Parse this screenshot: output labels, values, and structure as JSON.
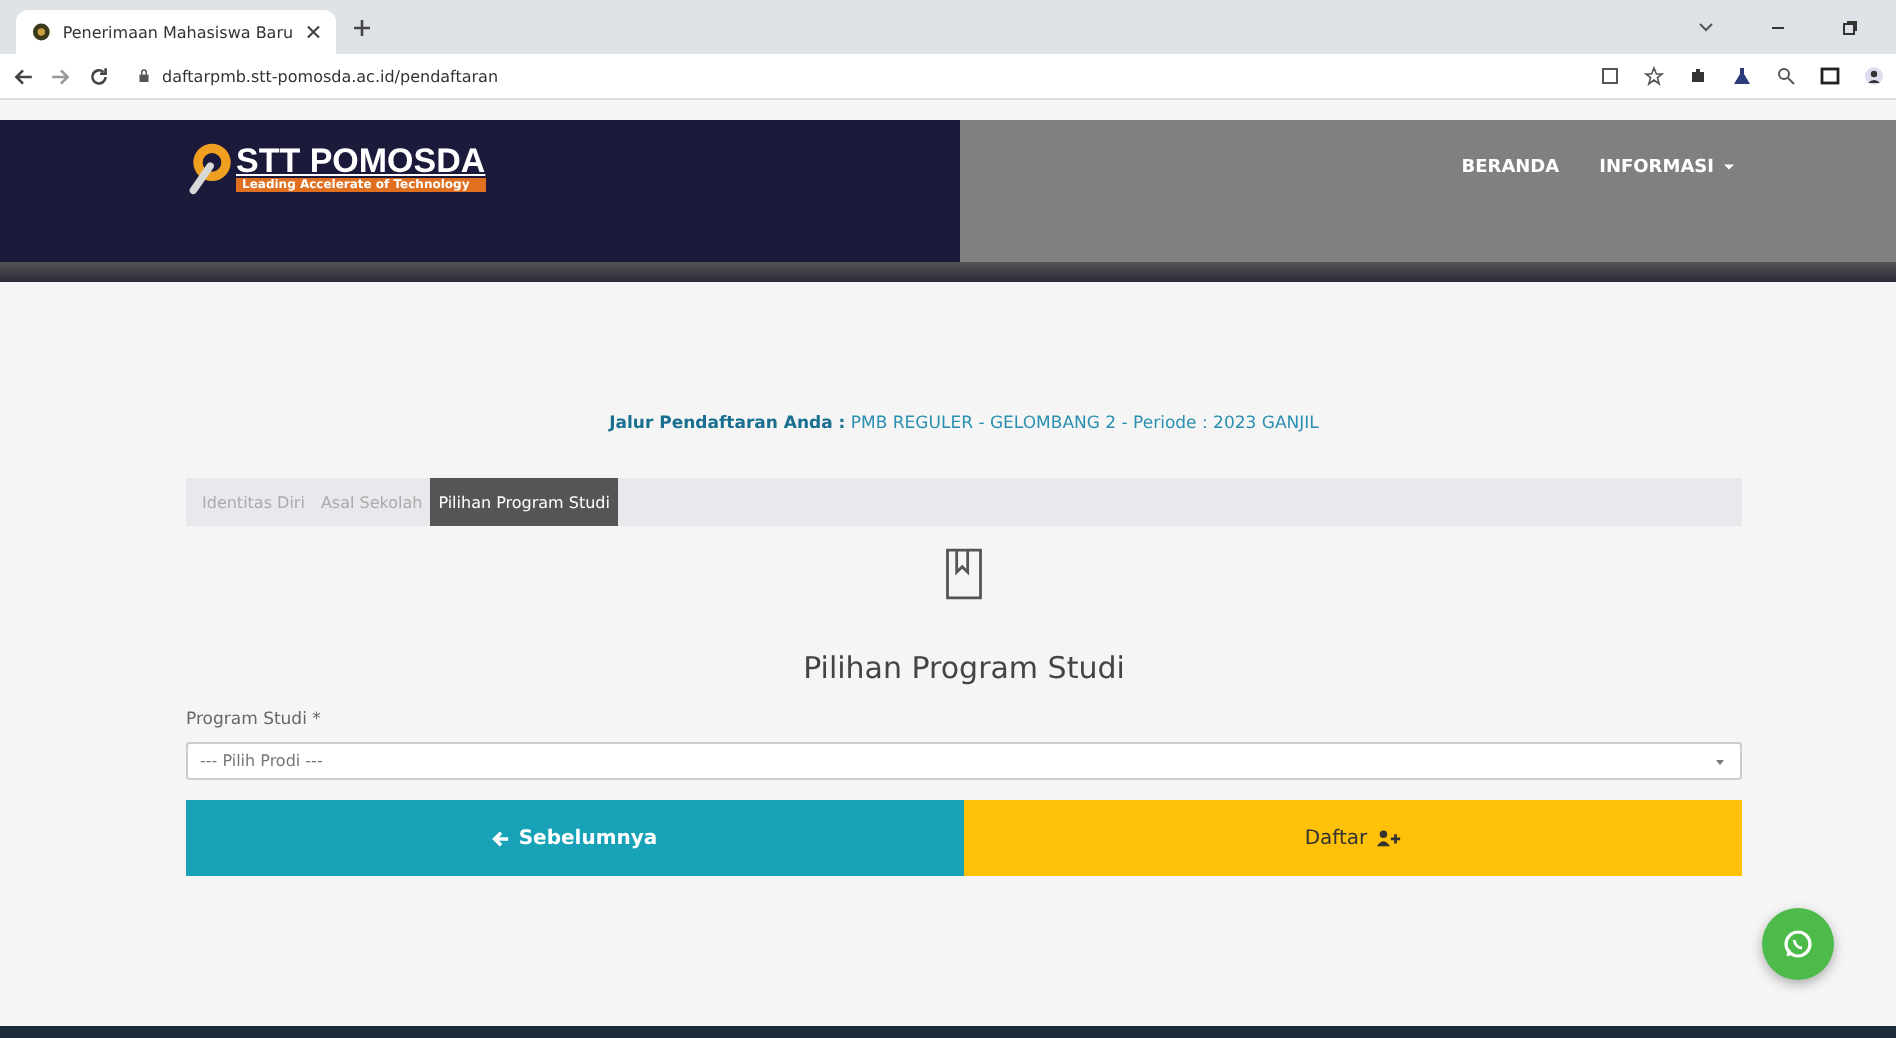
{
  "browser": {
    "tab_title": "Penerimaan Mahasiswa Baru",
    "url": "daftarpmb.stt-pomosda.ac.id/pendaftaran"
  },
  "header": {
    "logo_name": "STT POMOSDA",
    "logo_tagline": "Leading Accelerate of Technology",
    "nav": [
      {
        "label": "BERANDA",
        "dropdown": false
      },
      {
        "label": "INFORMASI",
        "dropdown": true
      }
    ]
  },
  "route": "**Jalur Pendaftaran Anda :** PMB REGULER - GELOMBANG 2 - Periode : 2023 GANJIL",
  "steps": [
    {
      "label": "Identitas Diri",
      "selected": false
    },
    {
      "label": "Asal Sekolah",
      "selected": false
    },
    {
      "label": "Pilihan Program Studi",
      "selected": true
    }
  ],
  "section_title": "Pilihan Program Studi",
  "field": {
    "label": "Program Studi *",
    "placeholder": "--- Pilih Prodi ---"
  },
  "buttons": [
    {
      "label": "Sebelumnya",
      "kind": "back"
    },
    {
      "label": "Daftar",
      "kind": "submit"
    }
  ]
}
